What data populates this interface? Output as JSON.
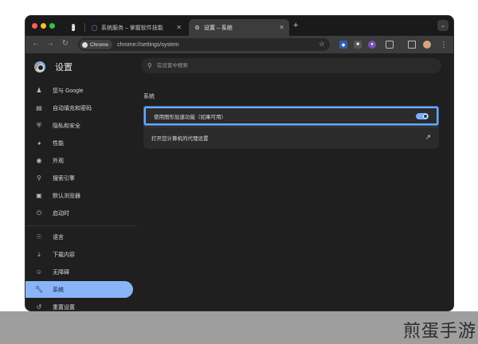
{
  "tabs": [
    {
      "label": "",
      "icon": "app-icon"
    },
    {
      "label": "系统服务 – 掌握软件技能",
      "icon": "site-icon"
    },
    {
      "label": "设置 – 系统",
      "icon": "gear-icon"
    }
  ],
  "toolbar": {
    "chip_label": "Chrome",
    "url": "chrome://settings/system"
  },
  "settings": {
    "title": "设置",
    "search_placeholder": "在设置中搜索"
  },
  "sidebar": {
    "items": [
      {
        "label": "您与 Google",
        "icon": "person-icon"
      },
      {
        "label": "自动填充和密码",
        "icon": "clipboard-icon"
      },
      {
        "label": "隐私和安全",
        "icon": "shield-icon"
      },
      {
        "label": "性能",
        "icon": "speedometer-icon"
      },
      {
        "label": "外观",
        "icon": "palette-icon"
      },
      {
        "label": "搜索引擎",
        "icon": "search-icon"
      },
      {
        "label": "默认浏览器",
        "icon": "browser-icon"
      },
      {
        "label": "启动时",
        "icon": "power-icon"
      },
      {
        "label": "语言",
        "icon": "globe-icon"
      },
      {
        "label": "下载内容",
        "icon": "download-icon"
      },
      {
        "label": "无障碍",
        "icon": "accessibility-icon"
      },
      {
        "label": "系统",
        "icon": "wrench-icon"
      },
      {
        "label": "重置设置",
        "icon": "reset-icon"
      }
    ]
  },
  "main": {
    "section_title": "系统",
    "rows": [
      {
        "label": "使用图形加速功能（如果可用）",
        "toggle_on": true
      },
      {
        "label": "打开您计算机的代理设置"
      }
    ]
  },
  "watermark": "煎蛋手游",
  "colors": {
    "accent": "#8ab4f8",
    "focus_ring": "#6aa7ff",
    "window_bg": "#1f1f1f"
  }
}
